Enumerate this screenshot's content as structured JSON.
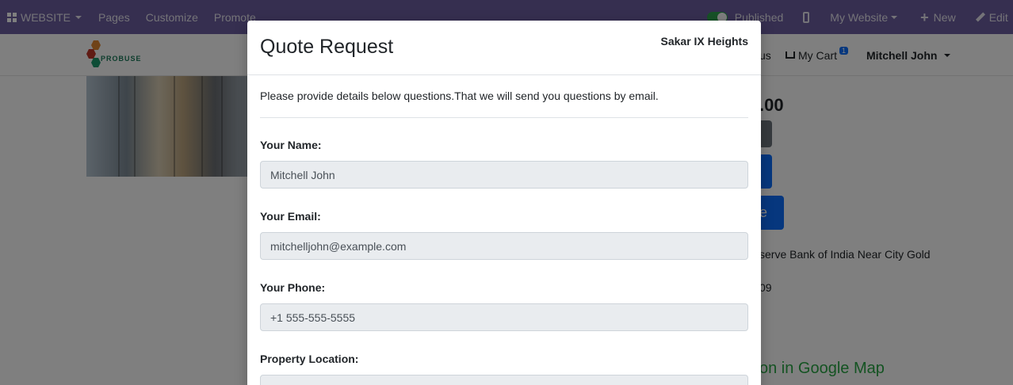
{
  "topbar": {
    "website_label": "WEBSITE",
    "pages_label": "Pages",
    "customize_label": "Customize",
    "promote_label": "Promote",
    "published_label": "Published",
    "my_website_label": "My Website",
    "new_label": "New",
    "edit_label": "Edit"
  },
  "header": {
    "logo_text": "PROBUSE",
    "nav_partial": "us",
    "cart_label": "My Cart",
    "cart_count": "1",
    "user_name": "Mitchell John"
  },
  "background": {
    "price_partial": ".00",
    "button_partial": "e",
    "address_partial": "serve Bank of India Near City Gold",
    "number_partial": "09",
    "map_partial": "on in Google Map"
  },
  "modal": {
    "title": "Quote Request",
    "property_name": "Sakar IX Heights",
    "intro": "Please provide details below questions.That we will send you questions by email.",
    "fields": [
      {
        "label": "Your Name:",
        "value": "Mitchell John"
      },
      {
        "label": "Your Email:",
        "value": "mitchelljohn@example.com"
      },
      {
        "label": "Your Phone:",
        "value": "+1 555-555-5555"
      },
      {
        "label": "Property Location:",
        "value": "Sakar IX Heights"
      }
    ]
  },
  "colors": {
    "topbar": "#6c5ea0",
    "primary": "#0d6efd",
    "map_link": "#28a745",
    "input_bg": "#e9ecef"
  }
}
